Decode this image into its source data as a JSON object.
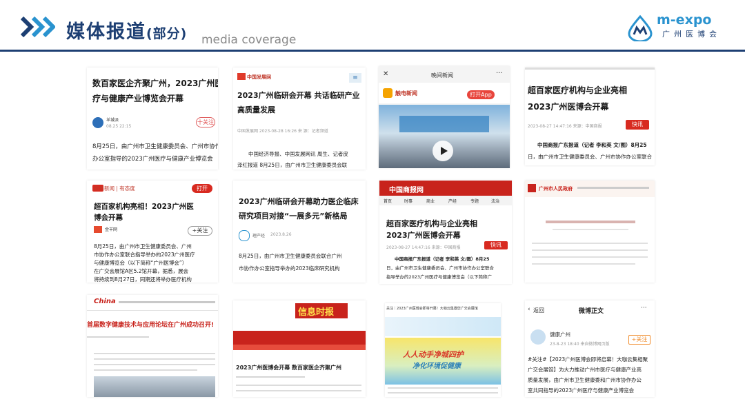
{
  "header": {
    "title": "媒体报道",
    "title_part": "(部分)",
    "subtitle": "media coverage",
    "logo_text": "m-expo",
    "logo_sub": "广州医博会",
    "accent": "#1d3f73",
    "logo_color": "#2a93cf"
  },
  "cards": {
    "c1": {
      "headline1": "数百家医企齐聚广州，2023广州医",
      "headline2": "疗与健康产业博览会开幕",
      "author": "羊城派",
      "date": "08.25 22:15",
      "follow": "十关注",
      "body1": "8月25日，由广州市卫生健康委员会、广州市协作",
      "body2": "办公室指导的2023广州医疗与健康产业博览会"
    },
    "c2": {
      "source": "中国发展网",
      "headline1": "2023广州临研会开幕 共话临研产业",
      "headline2": "高质量发展",
      "meta": "中国发展网    2023-08-28 16:26    来 源：记者频道",
      "body1": "中国经济导报、中国发展网讯 周生、记者皮",
      "body2": "泽红报道  8月25日，由广州市卫生健康委员会联"
    },
    "c3": {
      "app": "晚间新闻",
      "brand": "触电新闻",
      "open": "打开App"
    },
    "c4": {
      "headline1": "超百家医疗机构与企业亮相",
      "headline2": "2023广州医博会开幕",
      "meta": "2023-08-27 14:47:16  来源：中国商报",
      "btn": "快讯",
      "body1": "中国商报广东报道（记者 李和英 文/图）8月25",
      "body2": "日，由广州市卫生健康委员会、广州市协作办公室联合"
    },
    "c5": {
      "source": "网易新闻 | 有态度",
      "open": "打开",
      "headline1": "超百家机构亮相！2023广州医",
      "headline2": "博会开幕",
      "author": "金羊网",
      "follow": "+关注",
      "body1": "8月25日，由广州市卫生健康委员会、广州",
      "body2": "市协作办公室联合指导举办的2023广州医疗",
      "body3": "与健康博览会（以下简称“广州医博会”）",
      "body4": "在广交会展馆A区5.2馆开幕，据悉，展会",
      "body5": "将持续到8月27日，同期还将举办医疗机构"
    },
    "c6": {
      "headline1": "2023广州临研会开幕助力医企临床",
      "headline2": "研究项目对接“一展多元”新格局",
      "author": "理产经",
      "date": "2023.8.26",
      "body1": "8月25日，由广州市卫生健康委员会联合广州",
      "body2": "市协作办公室指导举办的2023临床研究机构"
    },
    "c7": {
      "masthead": "中国商报网",
      "nav": [
        "首页",
        "时事",
        "商业",
        "产经",
        "专题",
        "法治"
      ],
      "headline1": "超百家医疗机构与企业亮相",
      "headline2": "2023广州医博会开幕",
      "meta": "2023-08-27 14:47:16  来源：中国商报",
      "btn": "快讯",
      "body1": "中国商报广东报道（记者 李和英 文/图）8月25",
      "body2": "日，由广州市卫生健康委员会、广州市协作办公室联合",
      "body3": "指导举办的2023广州医疗与健康博览会（以下简称广"
    },
    "c8": {
      "masthead": "广州市人民政府"
    },
    "c9": {
      "logo": "China",
      "headline": "首届数字健康技术与应用论坛在广州成功召开!"
    },
    "c10": {
      "masthead": "信息时报",
      "headline": "2023广州医博会开幕 数百家医企齐聚广州"
    },
    "c11": {
      "top": "关注｜2023广州医博会即将开幕！大咖云集邀您广交会展馆",
      "banner1": "人人动手净城四护",
      "banner2": "净化环境促健康"
    },
    "c12": {
      "back": "返回",
      "title": "微博正文",
      "more": "···",
      "user": "健康广州",
      "date": "23-8-23 18:40 来自微博网页版",
      "follow": "+关注",
      "body1": "#关注#【2023广州医博会即将启幕！大咖云集相聚",
      "body2": "广交会展馆】为大力推动广州市医疗与健康产业高",
      "body3": "质量发展，由广州市卫生健康委和广州市协作办公",
      "body4": "室共同指导的2023广州医疗与健康产业博览会"
    }
  }
}
